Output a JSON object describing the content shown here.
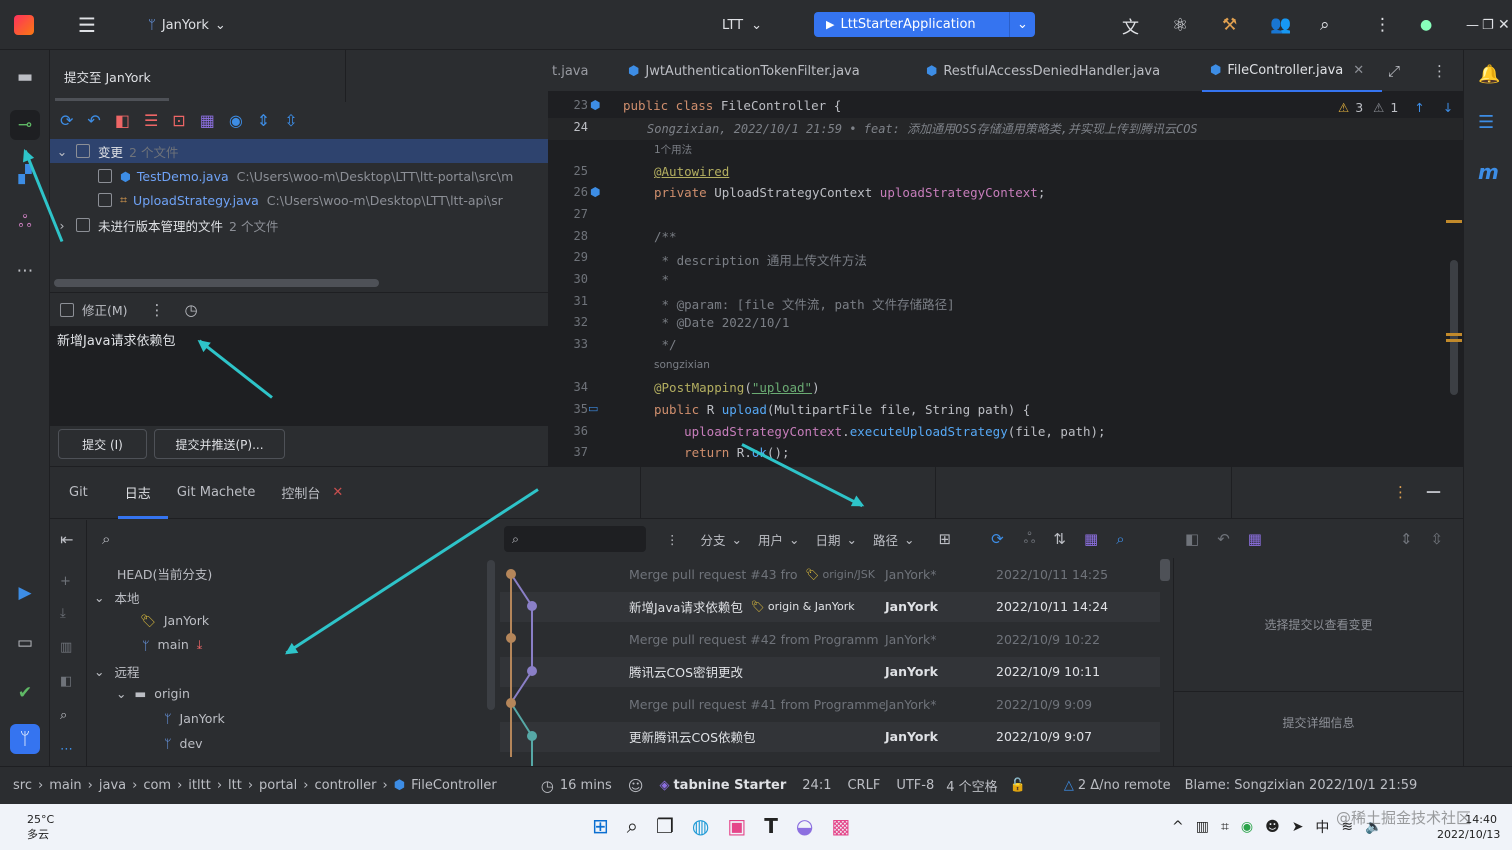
{
  "titlebar": {
    "branch": "JanYork",
    "project": "LTT",
    "run_config": "LttStarterApplication"
  },
  "commit": {
    "tab_title": "提交至 JanYork",
    "changes_label": "变更",
    "changes_count": "2 个文件",
    "files": [
      {
        "name": "TestDemo.java",
        "path": "C:\\Users\\woo-m\\Desktop\\LTT\\ltt-portal\\src\\m"
      },
      {
        "name": "UploadStrategy.java",
        "path": "C:\\Users\\woo-m\\Desktop\\LTT\\ltt-api\\sr"
      }
    ],
    "unversioned_label": "未进行版本管理的文件",
    "unversioned_count": "2 个文件",
    "amend_label": "修正(M)",
    "message": "新增Java请求依赖包",
    "commit_btn": "提交 (I)",
    "commit_push_btn": "提交并推送(P)..."
  },
  "editor": {
    "tabs": [
      "t.java",
      "JwtAuthenticationTokenFilter.java",
      "RestfulAccessDeniedHandler.java",
      "FileController.java"
    ],
    "warnings": "3",
    "weak_warnings": "1",
    "lines": [
      {
        "n": "23",
        "t": "public class FileController {"
      },
      {
        "n": "24",
        "t": "Songzixian, 2022/10/1 21:59 • feat: 添加通用OSS存储通用策略类,并实现上传到腾讯云COS"
      },
      {
        "n": "",
        "t": "1个用法"
      },
      {
        "n": "25",
        "t": "@Autowired"
      },
      {
        "n": "26",
        "t": "private UploadStrategyContext uploadStrategyContext;"
      },
      {
        "n": "27",
        "t": ""
      },
      {
        "n": "28",
        "t": "/**"
      },
      {
        "n": "29",
        "t": " * description 通用上传文件方法"
      },
      {
        "n": "30",
        "t": " *"
      },
      {
        "n": "31",
        "t": " * @param: [file 文件流, path 文件存储路径]"
      },
      {
        "n": "32",
        "t": " * @Date 2022/10/1"
      },
      {
        "n": "33",
        "t": " */"
      },
      {
        "n": "",
        "t": "songzixian"
      },
      {
        "n": "34",
        "t": "@PostMapping(\"upload\")"
      },
      {
        "n": "35",
        "t": "public R upload(MultipartFile file, String path) {"
      },
      {
        "n": "36",
        "t": "    uploadStrategyContext.executeUploadStrategy(file, path);"
      },
      {
        "n": "37",
        "t": "    return R.ok();"
      }
    ]
  },
  "bottom": {
    "tabs": [
      "Git",
      "日志",
      "Git Machete",
      "控制台"
    ],
    "branches": {
      "head": "HEAD(当前分支)",
      "local": "本地",
      "local_items": [
        "JanYork",
        "main"
      ],
      "remote": "远程",
      "origin": "origin",
      "remote_items": [
        "JanYork",
        "dev"
      ]
    },
    "filters": [
      "分支",
      "用户",
      "日期",
      "路径"
    ],
    "commits": [
      {
        "msg": "Merge pull request #43 fro",
        "tag": "origin/JSK",
        "author": "JanYork*",
        "date": "2022/10/11 14:25",
        "dim": true
      },
      {
        "msg": "新增Java请求依赖包",
        "tag": "origin & JanYork",
        "author": "JanYork",
        "date": "2022/10/11 14:24",
        "dim": false
      },
      {
        "msg": "Merge pull request #42 from Programm",
        "tag": "",
        "author": "JanYork*",
        "date": "2022/10/9 10:22",
        "dim": true
      },
      {
        "msg": "腾讯云COS密钥更改",
        "tag": "",
        "author": "JanYork",
        "date": "2022/10/9 10:11",
        "dim": false
      },
      {
        "msg": "Merge pull request #41 from Programme",
        "tag": "",
        "author": "JanYork*",
        "date": "2022/10/9 9:09",
        "dim": true
      },
      {
        "msg": "更新腾讯云COS依赖包",
        "tag": "",
        "author": "JanYork",
        "date": "2022/10/9 9:07",
        "dim": false
      }
    ],
    "select_commit": "选择提交以查看变更",
    "commit_details": "提交详细信息"
  },
  "status": {
    "breadcrumb": [
      "src",
      "main",
      "java",
      "com",
      "itltt",
      "ltt",
      "portal",
      "controller",
      "FileController"
    ],
    "time": "16 mins",
    "tabnine": "tabnine Starter",
    "pos": "24:1",
    "eol": "CRLF",
    "enc": "UTF-8",
    "indent": "4 个空格",
    "remote": "2 Δ/no remote",
    "blame": "Blame: Songzixian 2022/10/1 21:59"
  },
  "taskbar": {
    "temp": "25°C",
    "weather": "多云",
    "clock": "14:40",
    "date": "2022/10/13",
    "watermark": "@稀土掘金技术社区",
    "ime": "中"
  }
}
